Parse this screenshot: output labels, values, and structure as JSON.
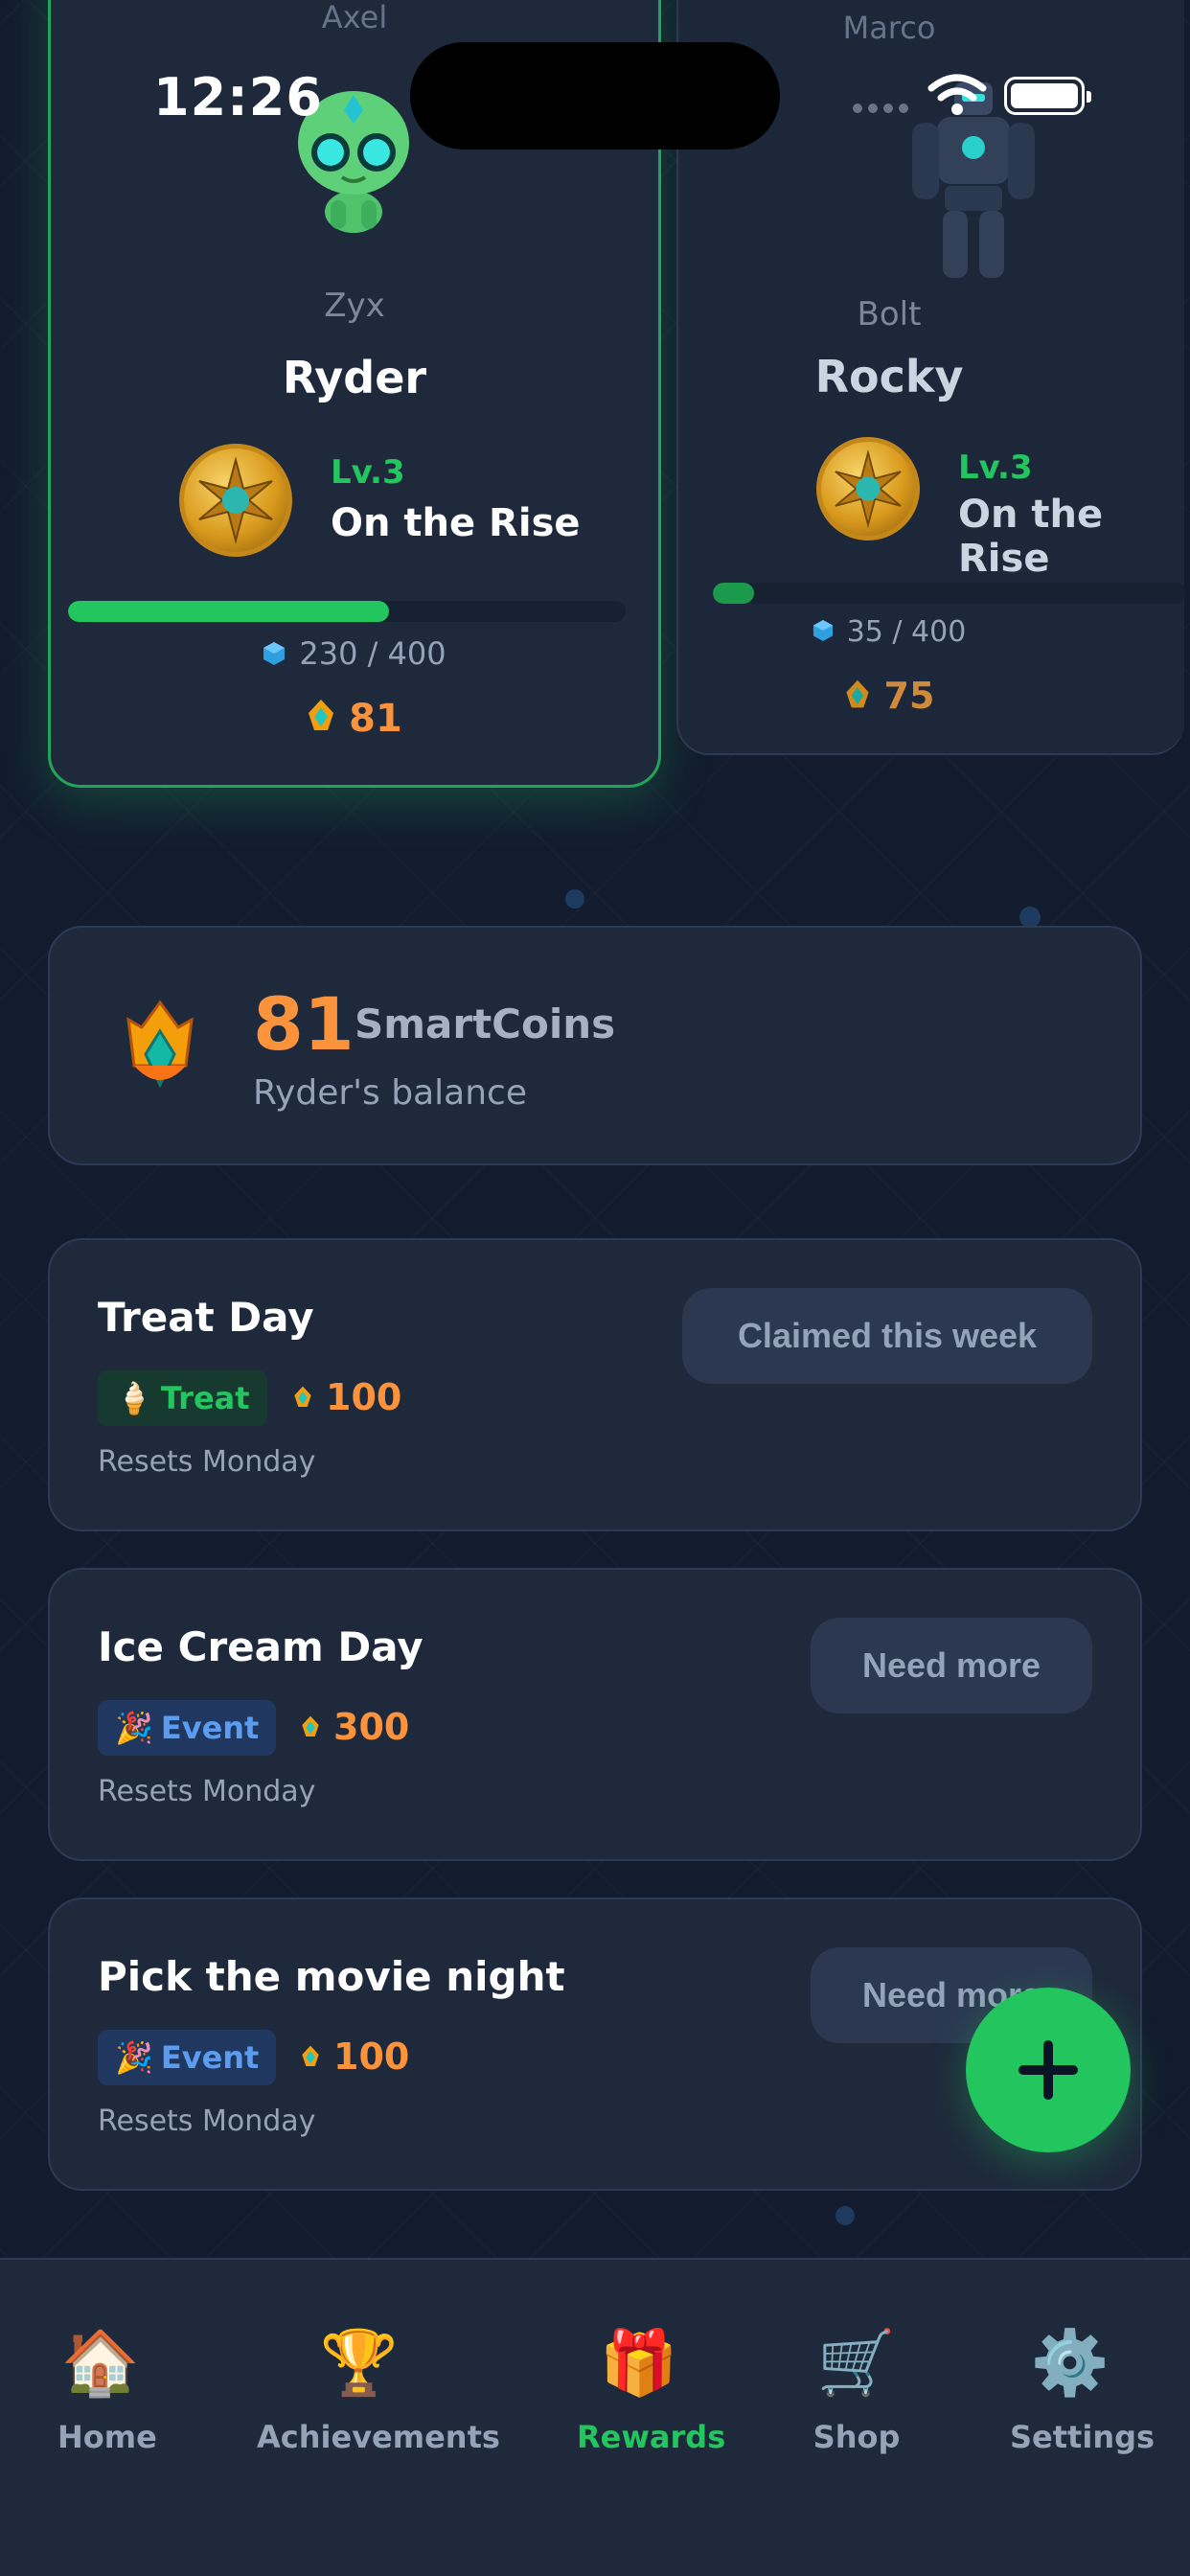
{
  "status_bar": {
    "time": "12:26"
  },
  "kids": [
    {
      "top_name": "Axel",
      "avatar_name": "Zyx",
      "name": "Ryder",
      "level": "Lv.3",
      "rank": "On the Rise",
      "xp_text": "230 / 400",
      "xp_progress": 0.575,
      "coins": "81",
      "active": true
    },
    {
      "top_name": "Marco",
      "avatar_name": "Bolt",
      "name": "Rocky",
      "level": "Lv.3",
      "rank": "On the Rise",
      "xp_text": "35 / 400",
      "xp_progress": 0.0875,
      "coins": "75",
      "active": false
    }
  ],
  "balance": {
    "amount": "81",
    "unit": "SmartCoins",
    "caption": "Ryder's balance"
  },
  "rewards": [
    {
      "title": "Treat Day",
      "tag": "Treat",
      "tag_icon": "ice-cream-icon",
      "cost": "100",
      "resets": "Resets Monday",
      "button": "Claimed this week"
    },
    {
      "title": "Ice Cream Day",
      "tag": "Event",
      "tag_icon": "party-popper-icon",
      "cost": "300",
      "resets": "Resets Monday",
      "button": "Need more"
    },
    {
      "title": "Pick the movie night",
      "tag": "Event",
      "tag_icon": "party-popper-icon",
      "cost": "100",
      "resets": "Resets Monday",
      "button": "Need more"
    }
  ],
  "fab": {
    "icon": "plus-icon"
  },
  "nav": [
    {
      "label": "Home",
      "icon": "🏠",
      "active": false
    },
    {
      "label": "Achievements",
      "icon": "🏆",
      "active": false
    },
    {
      "label": "Rewards",
      "icon": "🎁",
      "active": true
    },
    {
      "label": "Shop",
      "icon": "🛒",
      "active": false
    },
    {
      "label": "Settings",
      "icon": "⚙️",
      "active": false
    }
  ],
  "colors": {
    "accent": "#22c55e",
    "coin": "#fb923c",
    "background": "#121c2e",
    "card": "#1e293b"
  }
}
